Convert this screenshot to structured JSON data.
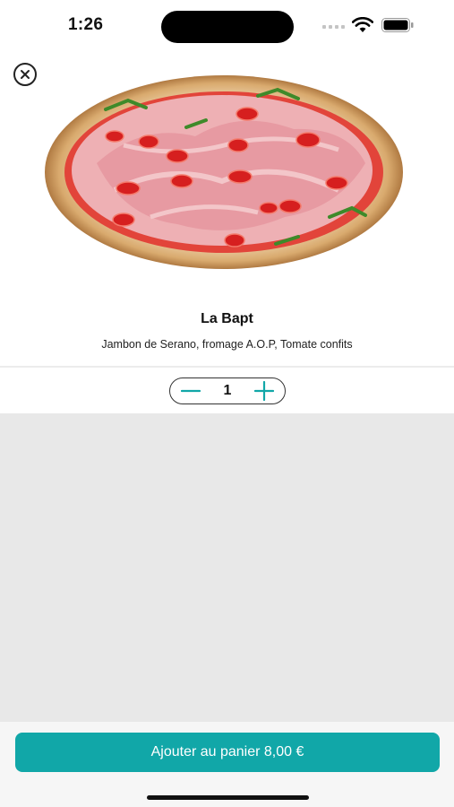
{
  "status_bar": {
    "time": "1:26"
  },
  "product": {
    "name": "La Bapt",
    "description": "Jambon de Serano, fromage A.O.P, Tomate confits",
    "image_icon": "pizza-image"
  },
  "quantity": {
    "value": "1",
    "minus_icon": "minus-icon",
    "plus_icon": "plus-icon"
  },
  "cart": {
    "button_label": "Ajouter au panier 8,00 €"
  },
  "colors": {
    "accent": "#11a7a8",
    "gray_area": "#e8e8e8",
    "footer": "#f6f6f6"
  }
}
